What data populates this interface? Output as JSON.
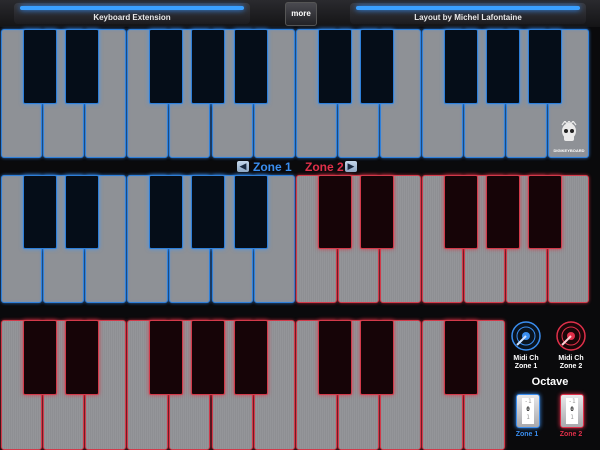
{
  "header": {
    "left_title": "Keyboard Extension",
    "more_label": "more",
    "right_title": "Layout by Michel Lafontaine"
  },
  "zones": {
    "zone1_label": "Zone 1",
    "zone2_label": "Zone 2",
    "zone1_color": "#3a8ef0",
    "zone2_color": "#e0304a"
  },
  "logo": {
    "text": "DIGIKEYBOARD"
  },
  "keyboards": [
    {
      "id": "row-1",
      "white_zones": [
        "blue",
        "blue",
        "blue",
        "blue",
        "blue",
        "blue",
        "blue",
        "blue",
        "blue",
        "blue",
        "blue",
        "blue",
        "blue",
        "blue"
      ]
    },
    {
      "id": "row-2",
      "white_zones": [
        "blue",
        "blue",
        "blue",
        "blue",
        "blue",
        "blue",
        "blue",
        "red",
        "red",
        "red",
        "red",
        "red",
        "red",
        "red"
      ]
    },
    {
      "id": "row-3",
      "white_zones": [
        "red",
        "red",
        "red",
        "red",
        "red",
        "red",
        "red",
        "red",
        "red",
        "red",
        "red",
        "red"
      ]
    }
  ],
  "controls": {
    "midi_zone1": {
      "label_line1": "Midi Ch",
      "label_line2": "Zone 1"
    },
    "midi_zone2": {
      "label_line1": "Midi Ch",
      "label_line2": "Zone 2"
    },
    "octave_title": "Octave",
    "octave_zone1": {
      "values": [
        "-1",
        "0",
        "1"
      ],
      "current": "0",
      "label": "Zone 1"
    },
    "octave_zone2": {
      "values": [
        "-1",
        "0",
        "1"
      ],
      "current": "0",
      "label": "Zone 2"
    }
  }
}
